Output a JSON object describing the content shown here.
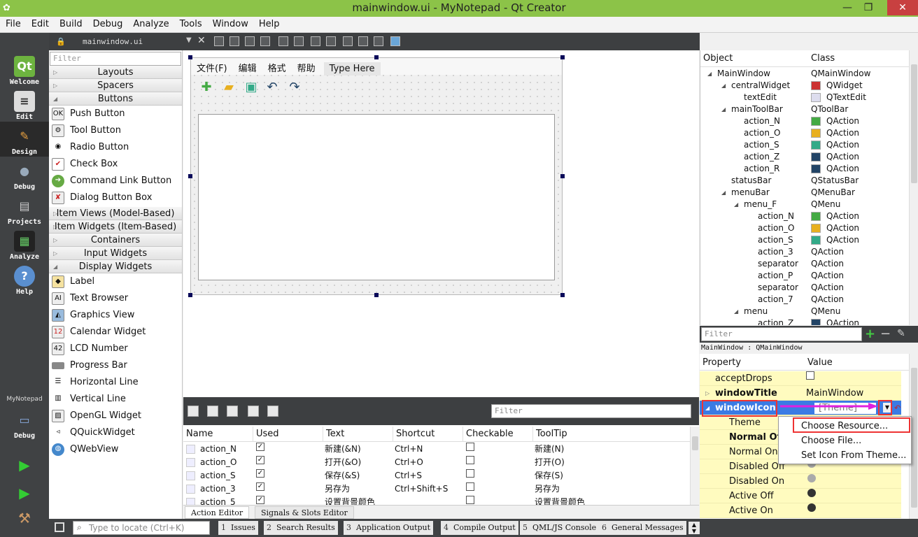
{
  "window": {
    "title": "mainwindow.ui - MyNotepad - Qt Creator",
    "minimize": "—",
    "maximize": "❐",
    "close": "✕"
  },
  "menubar": [
    "File",
    "Edit",
    "Build",
    "Debug",
    "Analyze",
    "Tools",
    "Window",
    "Help"
  ],
  "modes": [
    {
      "label": "Welcome",
      "icon": "Qt"
    },
    {
      "label": "Edit",
      "icon": "≡"
    },
    {
      "label": "Design",
      "icon": "✎"
    },
    {
      "label": "Debug",
      "icon": "●"
    },
    {
      "label": "Projects",
      "icon": "▤"
    },
    {
      "label": "Analyze",
      "icon": "▦"
    },
    {
      "label": "Help",
      "icon": "?"
    }
  ],
  "kit": {
    "project": "MyNotepad",
    "config": "Debug"
  },
  "editor": {
    "file_tab": "mainwindow.ui"
  },
  "widgetbox": {
    "filter_placeholder": "Filter",
    "categories": {
      "layouts": "Layouts",
      "spacers": "Spacers",
      "buttons": "Buttons",
      "item_views": "Item Views (Model-Based)",
      "item_widgets": "Item Widgets (Item-Based)",
      "containers": "Containers",
      "input_widgets": "Input Widgets",
      "display_widgets": "Display Widgets"
    },
    "buttons": [
      "Push Button",
      "Tool Button",
      "Radio Button",
      "Check Box",
      "Command Link Button",
      "Dialog Button Box"
    ],
    "display": [
      "Label",
      "Text Browser",
      "Graphics View",
      "Calendar Widget",
      "LCD Number",
      "Progress Bar",
      "Horizontal Line",
      "Vertical Line",
      "OpenGL Widget",
      "QQuickWidget",
      "QWebView"
    ]
  },
  "form": {
    "menus": [
      "文件(F)",
      "编辑",
      "格式",
      "帮助",
      "Type Here"
    ]
  },
  "action_editor": {
    "filter_placeholder": "Filter",
    "columns": [
      "Name",
      "Used",
      "Text",
      "Shortcut",
      "Checkable",
      "ToolTip"
    ],
    "rows": [
      {
        "name": "action_N",
        "used": "✓",
        "text": "新建(&N)",
        "shortcut": "Ctrl+N",
        "checkable": "",
        "tooltip": "新建(N)"
      },
      {
        "name": "action_O",
        "used": "✓",
        "text": "打开(&O)",
        "shortcut": "Ctrl+O",
        "checkable": "",
        "tooltip": "打开(O)"
      },
      {
        "name": "action_S",
        "used": "✓",
        "text": "保存(&S)",
        "shortcut": "Ctrl+S",
        "checkable": "",
        "tooltip": "保存(S)"
      },
      {
        "name": "action_3",
        "used": "✓",
        "text": "另存为",
        "shortcut": "Ctrl+Shift+S",
        "checkable": "",
        "tooltip": "另存为"
      },
      {
        "name": "action_5",
        "used": "✓",
        "text": "设置背景颜色",
        "shortcut": "",
        "checkable": "",
        "tooltip": "设置背景颜色"
      }
    ],
    "tabs": [
      "Action Editor",
      "Signals & Slots Editor"
    ]
  },
  "object_inspector": {
    "columns": [
      "Object",
      "Class"
    ],
    "rows": [
      {
        "object": "MainWindow",
        "class": "QMainWindow"
      },
      {
        "object": "centralWidget",
        "class": "QWidget"
      },
      {
        "object": "textEdit",
        "class": "QTextEdit"
      },
      {
        "object": "mainToolBar",
        "class": "QToolBar"
      },
      {
        "object": "action_N",
        "class": "QAction"
      },
      {
        "object": "action_O",
        "class": "QAction"
      },
      {
        "object": "action_S",
        "class": "QAction"
      },
      {
        "object": "action_Z",
        "class": "QAction"
      },
      {
        "object": "action_R",
        "class": "QAction"
      },
      {
        "object": "statusBar",
        "class": "QStatusBar"
      },
      {
        "object": "menuBar",
        "class": "QMenuBar"
      },
      {
        "object": "menu_F",
        "class": "QMenu"
      },
      {
        "object": "action_N",
        "class": "QAction"
      },
      {
        "object": "action_O",
        "class": "QAction"
      },
      {
        "object": "action_S",
        "class": "QAction"
      },
      {
        "object": "action_3",
        "class": "QAction"
      },
      {
        "object": "separator",
        "class": "QAction"
      },
      {
        "object": "action_P",
        "class": "QAction"
      },
      {
        "object": "separator",
        "class": "QAction"
      },
      {
        "object": "action_7",
        "class": "QAction"
      },
      {
        "object": "menu",
        "class": "QMenu"
      },
      {
        "object": "action_Z",
        "class": "QAction"
      }
    ]
  },
  "property_editor": {
    "filter_placeholder": "Filter",
    "class_label": "MainWindow : QMainWindow",
    "columns": [
      "Property",
      "Value"
    ],
    "rows": {
      "acceptDrops": "acceptDrops",
      "windowTitle": "windowTitle",
      "windowTitle_value": "MainWindow",
      "windowIcon": "windowIcon",
      "windowIcon_value": "[Theme]",
      "theme": "Theme",
      "normal_off": "Normal Off",
      "normal_on": "Normal On",
      "disabled_off": "Disabled Off",
      "disabled_on": "Disabled On",
      "active_off": "Active Off",
      "active_on": "Active On"
    },
    "popup": [
      "Choose Resource...",
      "Choose File...",
      "Set Icon From Theme..."
    ]
  },
  "statusbar": {
    "locator_placeholder": "Type to locate (Ctrl+K)",
    "tabs": [
      {
        "n": "1",
        "label": "Issues"
      },
      {
        "n": "2",
        "label": "Search Results"
      },
      {
        "n": "3",
        "label": "Application Output"
      },
      {
        "n": "4",
        "label": "Compile Output"
      },
      {
        "n": "5",
        "label": "QML/JS Console"
      },
      {
        "n": "6",
        "label": "General Messages"
      }
    ]
  },
  "colors": {
    "accent": "#8cc348",
    "selection": "#3b7be4",
    "highlight_box": "#e33333",
    "arrow": "#e020e0"
  }
}
